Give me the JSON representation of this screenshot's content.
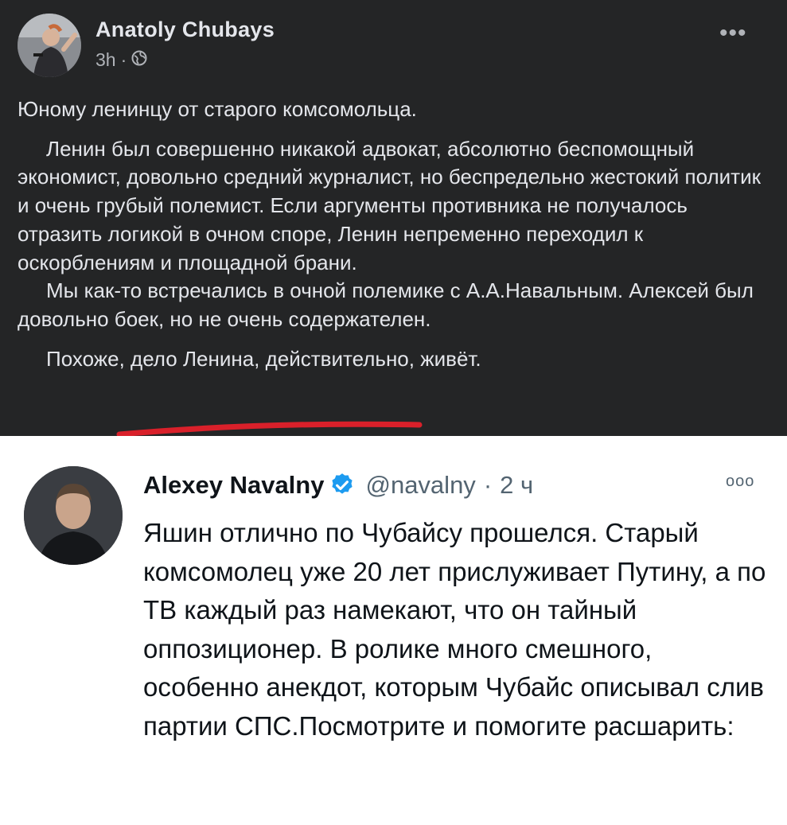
{
  "facebook_post": {
    "author": "Anatoly Chubays",
    "time": "3h",
    "separator": "·",
    "privacy_icon": "globe-icon",
    "more_icon": "more-horizontal-icon",
    "more_glyph": "•••",
    "paragraphs": [
      "Юному ленинцу от старого комсомольца.",
      "Ленин был совершенно никакой адвокат, абсолютно беспомощный экономист, довольно средний журналист, но беспредельно жестокий политик и очень грубый полемист. Если аргументы противника не получалось отразить логикой в очном споре, Ленин непременно переходил к оскорблениям и площадной брани.",
      "Мы как-то встречались в очной полемике с А.А.Навальным. Алексей был довольно боек, но не очень содержателен.",
      "Похоже, дело Ленина, действительно, живёт."
    ],
    "annotation_color": "#d9202a"
  },
  "tweet": {
    "name": "Alexey Navalny",
    "verified_icon": "verified-badge-icon",
    "verified_color": "#1d9bf0",
    "handle": "@navalny",
    "separator": "·",
    "time": "2 ч",
    "more_icon": "more-horizontal-icon",
    "more_glyph": "ooo",
    "text": "Яшин отлично по Чубайсу прошелся. Старый комсомолец уже 20 лет прислуживает Путину, а по ТВ каждый раз намекают, что он тайный оппозиционер. В ролике много смешного, особенно анекдот, которым Чубайс описывал слив партии СПС.Посмотрите и помогите расшарить:"
  }
}
